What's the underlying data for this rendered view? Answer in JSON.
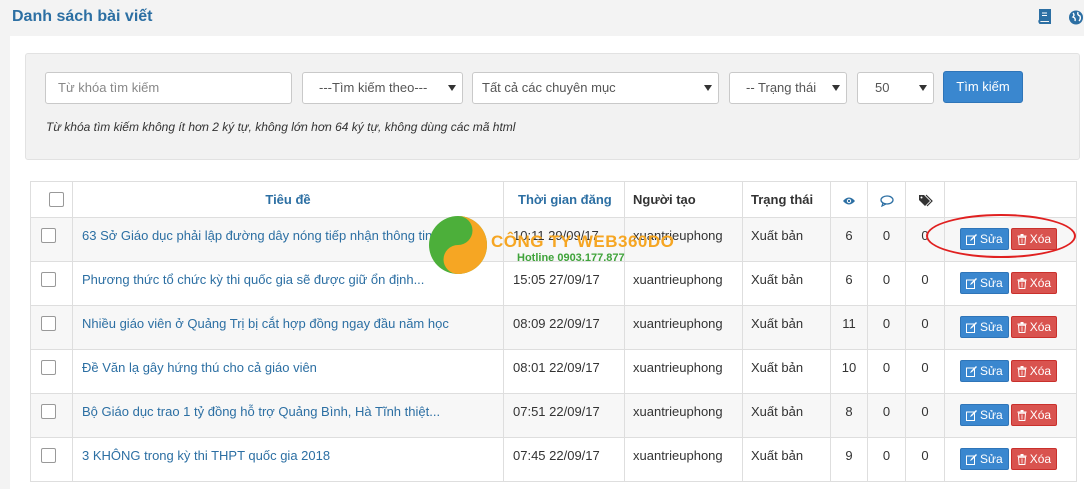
{
  "header": {
    "title": "Danh sách bài viết",
    "icons": [
      "book-icon",
      "globe-icon"
    ]
  },
  "search": {
    "keyword_placeholder": "Từ khóa tìm kiếm",
    "search_by": "---Tìm kiếm theo---",
    "category": "Tất cả các chuyên mục",
    "status": "-- Trạng thái",
    "per_page": "50",
    "button_label": "Tìm kiếm",
    "hint": "Từ khóa tìm kiếm không ít hơn 2 ký tự, không lớn hơn 64 ký tự, không dùng các mã html"
  },
  "table": {
    "columns": {
      "title": "Tiêu đề",
      "time": "Thời gian đăng",
      "creator": "Người tạo",
      "status": "Trạng thái",
      "views_icon": "eye-icon",
      "comments_icon": "comment-icon",
      "tags_icon": "tags-icon"
    },
    "edit_label": "Sửa",
    "delete_label": "Xóa",
    "rows": [
      {
        "title": "63 Sở Giáo dục phải lập đường dây nóng tiếp nhận thông tin",
        "time": "10:11 29/09/17",
        "creator": "xuantrieuphong",
        "status": "Xuất bản",
        "views": "6",
        "comments": "0",
        "tags": "0"
      },
      {
        "title": "Phương thức tổ chức kỳ thi quốc gia sẽ được giữ ổn định...",
        "time": "15:05 27/09/17",
        "creator": "xuantrieuphong",
        "status": "Xuất bản",
        "views": "6",
        "comments": "0",
        "tags": "0"
      },
      {
        "title": "Nhiều giáo viên ở Quảng Trị bị cắt hợp đồng ngay đầu năm học",
        "time": "08:09 22/09/17",
        "creator": "xuantrieuphong",
        "status": "Xuất bản",
        "views": "11",
        "comments": "0",
        "tags": "0"
      },
      {
        "title": "Đề Văn lạ gây hứng thú cho cả giáo viên",
        "time": "08:01 22/09/17",
        "creator": "xuantrieuphong",
        "status": "Xuất bản",
        "views": "10",
        "comments": "0",
        "tags": "0"
      },
      {
        "title": "Bộ Giáo dục trao 1 tỷ đồng hỗ trợ Quảng Bình, Hà Tĩnh thiệt...",
        "time": "07:51 22/09/17",
        "creator": "xuantrieuphong",
        "status": "Xuất bản",
        "views": "8",
        "comments": "0",
        "tags": "0"
      },
      {
        "title": "3 KHÔNG trong kỳ thi THPT quốc gia 2018",
        "time": "07:45 22/09/17",
        "creator": "xuantrieuphong",
        "status": "Xuất bản",
        "views": "9",
        "comments": "0",
        "tags": "0"
      }
    ]
  },
  "watermark": {
    "company": "CÔNG TY WEB360DO",
    "hotline": "Hotline 0903.177.877"
  },
  "colors": {
    "link": "#2c6fa3",
    "primary": "#3a87cf",
    "danger": "#d9534f",
    "highlight_ring": "#e02020"
  }
}
